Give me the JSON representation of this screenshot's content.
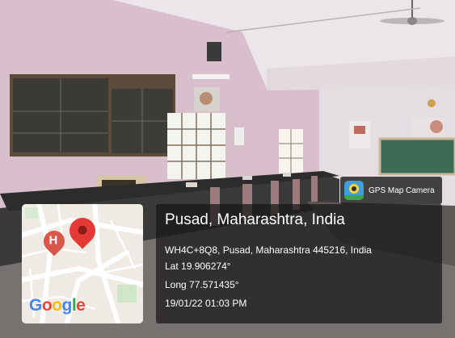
{
  "badge": {
    "app_name": "GPS Map Camera",
    "icon": "gps-map-camera-logo"
  },
  "location": {
    "title": "Pusad, Maharashtra, India",
    "address": "WH4C+8Q8, Pusad, Maharashtra 445216, India",
    "latitude": "Lat 19.906274°",
    "longitude": "Long 77.571435°",
    "datetime": "19/01/22 01:03 PM"
  },
  "map": {
    "brand": [
      "G",
      "o",
      "o",
      "g",
      "l",
      "e"
    ],
    "brand_colors": [
      "#4285f4",
      "#ea4335",
      "#fbbc05",
      "#4285f4",
      "#34a853",
      "#ea4335"
    ],
    "marker_icon": "red-map-pin-icon",
    "hospital_icon": "hospital-marker-icon",
    "hospital_letter": "H"
  },
  "colors": {
    "pin_red": "#e53935",
    "hospital_red": "#d9574a",
    "panel_bg": "#161616"
  }
}
